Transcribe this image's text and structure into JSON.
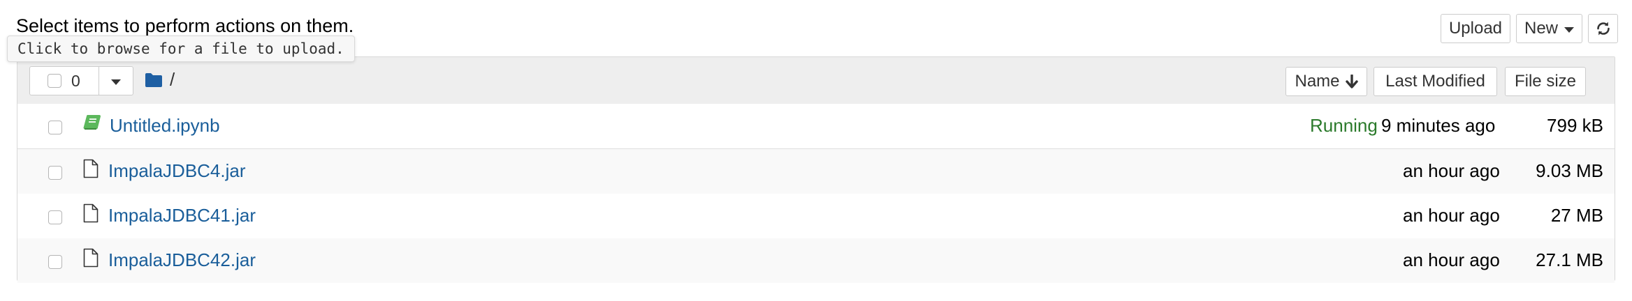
{
  "page": {
    "instruction": "Select items to perform actions on them.",
    "tooltip": "Click to browse for a file to upload."
  },
  "toolbar": {
    "upload_label": "Upload",
    "new_label": "New",
    "refresh_icon": "refresh-icon"
  },
  "list_header": {
    "selected_count": "0",
    "breadcrumb_separator": "/",
    "sort_name_label": "Name",
    "sort_last_modified_label": "Last Modified",
    "sort_file_size_label": "File size"
  },
  "files": [
    {
      "name": "Untitled.ipynb",
      "status": "Running",
      "modified": "9 minutes ago",
      "size": "799 kB",
      "icon": "notebook-icon"
    },
    {
      "name": "ImpalaJDBC4.jar",
      "status": "",
      "modified": "an hour ago",
      "size": "9.03 MB",
      "icon": "file-icon"
    },
    {
      "name": "ImpalaJDBC41.jar",
      "status": "",
      "modified": "an hour ago",
      "size": "27 MB",
      "icon": "file-icon"
    },
    {
      "name": "ImpalaJDBC42.jar",
      "status": "",
      "modified": "an hour ago",
      "size": "27.1 MB",
      "icon": "file-icon"
    }
  ],
  "colors": {
    "link": "#1a5e9a",
    "running": "#2b7a2b",
    "header_bg": "#eeeeee",
    "folder": "#1e5fa3",
    "notebook": "#5cb85c"
  }
}
